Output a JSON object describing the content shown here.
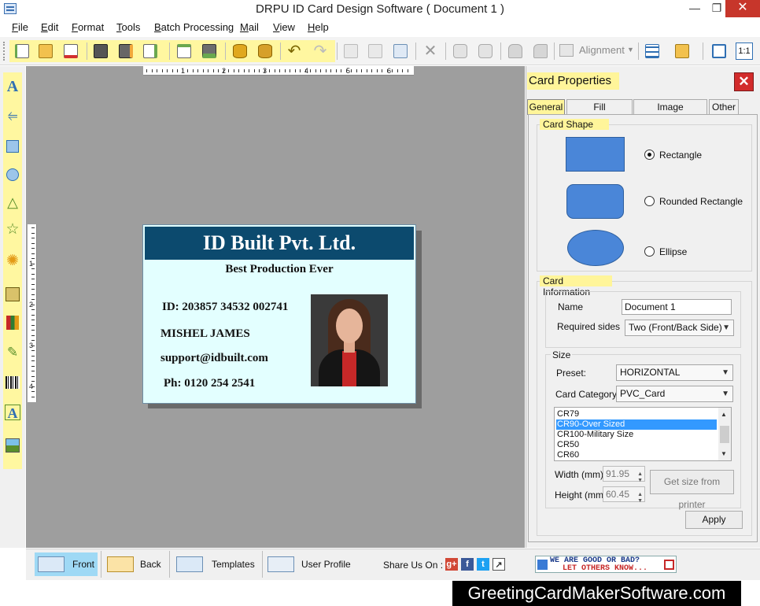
{
  "window": {
    "title": "DRPU ID Card Design Software ( Document 1 )"
  },
  "menu": [
    "File",
    "Edit",
    "Format",
    "Tools",
    "Batch Processing",
    "Mail",
    "View",
    "Help"
  ],
  "toolbar": {
    "alignment_label": "Alignment",
    "tools": [
      "new-icon",
      "open-icon",
      "close-doc-icon",
      "save-icon",
      "save-as-icon",
      "export-icon",
      "edit-icon",
      "print-icon",
      "database-icon",
      "database-2-icon",
      "undo-icon",
      "redo-icon",
      "cut-icon",
      "copy-icon",
      "paste-icon",
      "delete-icon",
      "bring-front-icon",
      "send-back-icon",
      "lock-icon",
      "unlock-icon",
      "grid-icon",
      "mail-icon",
      "fit-icon",
      "actual-size-icon"
    ],
    "actual_size_label": "1:1"
  },
  "left_tools": [
    "text-icon",
    "line-icon",
    "rectangle-icon",
    "ellipse-icon",
    "triangle-icon",
    "star-icon",
    "puzzle-icon",
    "image-icon",
    "library-icon",
    "signature-icon",
    "barcode-icon",
    "watermark-icon",
    "picture-icon"
  ],
  "rulers": {
    "horizontal": [
      "1",
      "2",
      "3",
      "4",
      "5",
      "6"
    ],
    "vertical": [
      "1",
      "2",
      "3",
      "4"
    ]
  },
  "card": {
    "company": "ID Built Pvt. Ltd.",
    "tagline": "Best Production Ever",
    "id_line": "ID: 203857 34532 002741",
    "name": "MISHEL JAMES",
    "email": "support@idbuilt.com",
    "phone": "Ph: 0120 254 2541",
    "colors": {
      "header": "#0c4a6e",
      "background": "#e3ffff"
    }
  },
  "properties": {
    "title": "Card Properties",
    "close_symbol": "✕",
    "tabs": [
      "General",
      "Fill Background",
      "Image Processing",
      "Other"
    ],
    "card_shape": {
      "label": "Card Shape",
      "options": [
        "Rectangle",
        "Rounded Rectangle",
        "Ellipse"
      ],
      "selected": "Rectangle"
    },
    "card_info": {
      "label": "Card Information",
      "name_label": "Name",
      "name_value": "Document 1",
      "sides_label": "Required sides",
      "sides_value": "Two (Front/Back Side)"
    },
    "size": {
      "label": "Size",
      "preset_label": "Preset:",
      "preset_value": "HORIZONTAL",
      "category_label": "Card Category",
      "category_value": "PVC_Card",
      "list": [
        "CR79",
        "CR90-Over Sized",
        "CR100-Military Size",
        "CR50",
        "CR60"
      ],
      "list_selected": "CR90-Over Sized",
      "width_label": "Width  (mm)",
      "width_value": "91.95",
      "height_label": "Height  (mm)",
      "height_value": "60.45",
      "printer_button": "Get size from printer"
    },
    "apply_button": "Apply"
  },
  "bottom": {
    "buttons": [
      "Front",
      "Back",
      "Templates",
      "User Profile"
    ],
    "share_label": "Share Us On :",
    "feedback_line1": "WE ARE GOOD OR BAD?",
    "feedback_line2": "LET OTHERS KNOW..."
  },
  "watermark": "GreetingCardMakerSoftware.com"
}
